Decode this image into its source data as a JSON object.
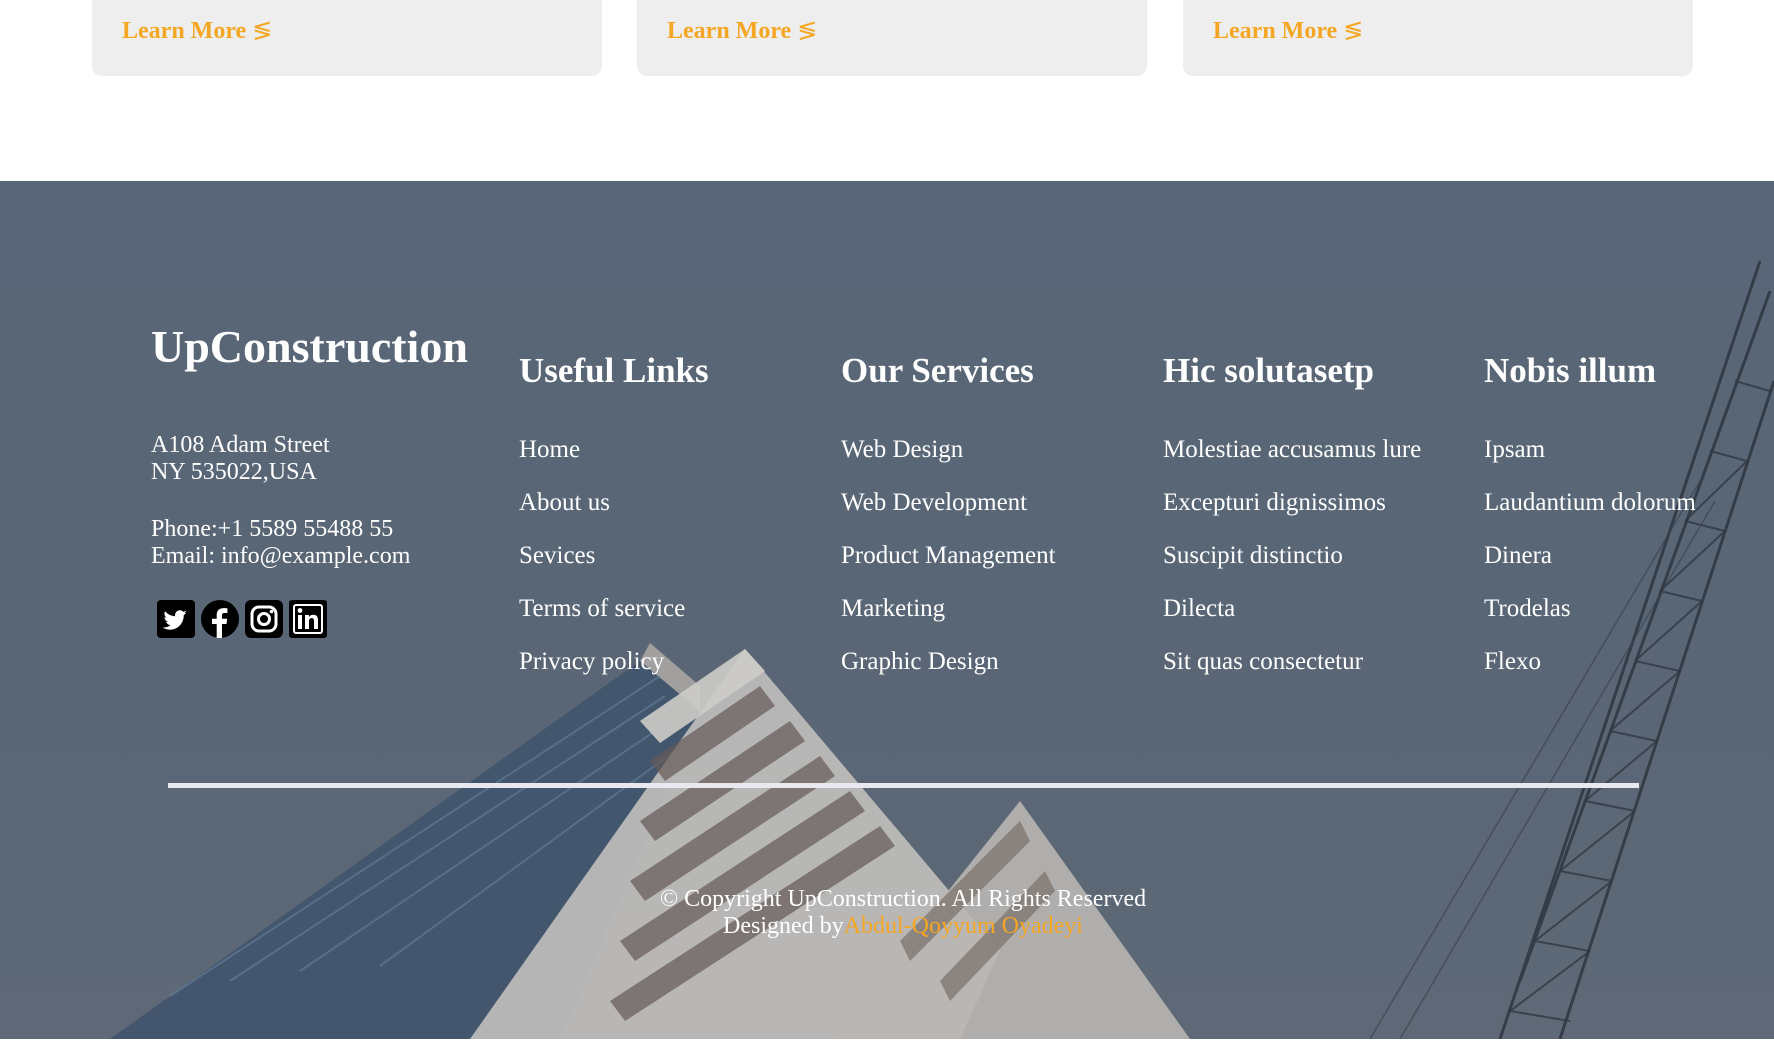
{
  "cards": [
    {
      "learn_more_label": "Learn More",
      "arrow_glyph": "≶"
    },
    {
      "learn_more_label": "Learn More",
      "arrow_glyph": "≶"
    },
    {
      "learn_more_label": "Learn More",
      "arrow_glyph": "≶"
    }
  ],
  "colors": {
    "accent": "#f5a623",
    "card_bg": "#eeeeee",
    "footer_text": "#ffffff"
  },
  "footer": {
    "brand": "UpConstruction",
    "address_line1": "A108 Adam Street",
    "address_line2": "NY 535022,USA",
    "phone_label": "Phone:",
    "phone": "+1 5589 55488 55",
    "email_label": "Email:",
    "email": "info@example.com",
    "socials": [
      {
        "icon": "twitter-icon"
      },
      {
        "icon": "facebook-icon"
      },
      {
        "icon": "instagram-icon"
      },
      {
        "icon": "linkedin-icon"
      }
    ],
    "columns": [
      {
        "title": "Useful Links",
        "items": [
          "Home",
          "About us",
          "Sevices",
          "Terms of service",
          "Privacy policy"
        ]
      },
      {
        "title": "Our Services",
        "items": [
          "Web Design",
          "Web Development",
          "Product Management",
          "Marketing",
          "Graphic Design"
        ]
      },
      {
        "title": "Hic solutasetp",
        "items": [
          "Molestiae accusamus lure",
          "Excepturi dignissimos",
          "Suscipit distinctio",
          "Dilecta",
          "Sit quas consectetur"
        ]
      },
      {
        "title": "Nobis illum",
        "items": [
          "Ipsam",
          "Laudantium dolorum",
          "Dinera",
          "Trodelas",
          "Flexo"
        ]
      }
    ],
    "copyright": "© Copyright UpConstruction. All Rights Reserved",
    "designed_by_label": "Designed by",
    "designer": "Abdul-Qoyyum Oyadeyi"
  }
}
